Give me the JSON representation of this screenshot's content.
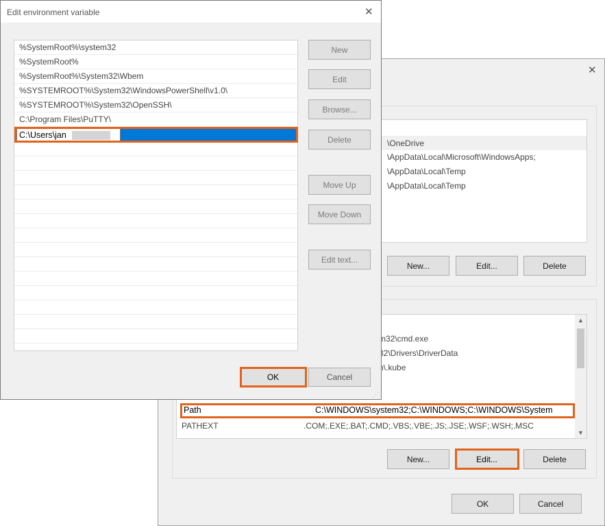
{
  "edit_dialog": {
    "title": "Edit environment variable",
    "close_icon": "✕",
    "entries": [
      "%SystemRoot%\\system32",
      "%SystemRoot%",
      "%SystemRoot%\\System32\\Wbem",
      "%SYSTEMROOT%\\System32\\WindowsPowerShell\\v1.0\\",
      "%SYSTEMROOT%\\System32\\OpenSSH\\",
      "C:\\Program Files\\PuTTY\\"
    ],
    "editing_value": "C:\\Users\\jan",
    "buttons": {
      "new": "New",
      "edit": "Edit",
      "browse": "Browse...",
      "delete": "Delete",
      "move_up": "Move Up",
      "move_down": "Move Down",
      "edit_text": "Edit text..."
    },
    "ok": "OK",
    "cancel": "Cancel"
  },
  "env_dialog": {
    "close_icon": "✕",
    "user_vars": [
      "\\OneDrive",
      "\\AppData\\Local\\Microsoft\\WindowsApps;",
      "\\AppData\\Local\\Temp",
      "\\AppData\\Local\\Temp"
    ],
    "user_buttons": {
      "new": "New...",
      "edit": "Edit...",
      "delete": "Delete"
    },
    "system_vars_partial": [
      "m32\\cmd.exe",
      "32\\Drivers\\DriverData",
      "h\\.kube"
    ],
    "system_rows": [
      {
        "name": "Path",
        "value": "C:\\WINDOWS\\system32;C:\\WINDOWS;C:\\WINDOWS\\System"
      },
      {
        "name": "PATHEXT",
        "value": ".COM;.EXE;.BAT;.CMD;.VBS;.VBE;.JS;.JSE;.WSF;.WSH;.MSC"
      }
    ],
    "system_buttons": {
      "new": "New...",
      "edit": "Edit...",
      "delete": "Delete"
    },
    "ok": "OK",
    "cancel": "Cancel"
  },
  "colors": {
    "highlight": "#e2621b",
    "selection": "#0078d7"
  }
}
